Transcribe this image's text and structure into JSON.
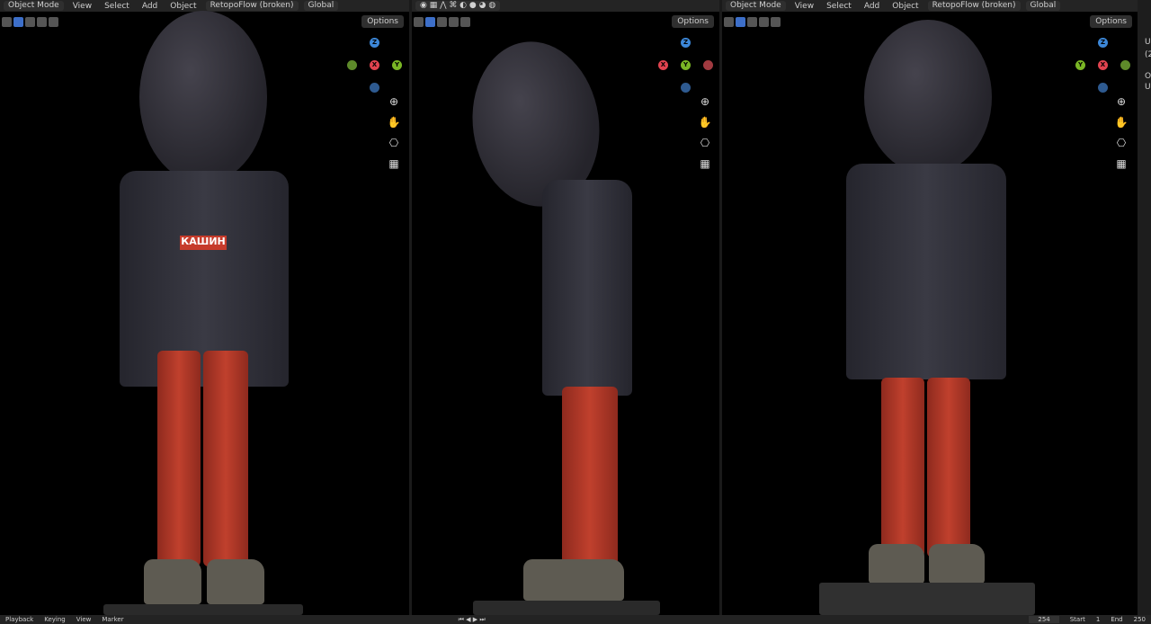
{
  "header": {
    "mode": "Object Mode",
    "menus": [
      "View",
      "Select",
      "Add",
      "Object"
    ],
    "addon": "RetopoFlow (broken)",
    "transform": "Global",
    "options": "Options"
  },
  "viewports": [
    {
      "name": "front",
      "gizmo": [
        "Z",
        "X",
        "Y"
      ],
      "shirt_text": "КАШИН"
    },
    {
      "name": "side",
      "gizmo": [
        "Z",
        "X",
        "Y"
      ]
    },
    {
      "name": "back",
      "gizmo": [
        "Z",
        "X",
        "Y"
      ]
    }
  ],
  "icons": {
    "zoom": "magnifier-plus-icon",
    "pan": "hand-icon",
    "camera": "camera-icon",
    "grid": "grid-icon"
  },
  "timeline": {
    "menus": [
      "Playback",
      "Keying",
      "View",
      "Marker"
    ],
    "current_frame": "254",
    "start_label": "Start",
    "start": "1",
    "end_label": "End",
    "end": "250"
  },
  "side_panel": [
    "U",
    "(2",
    "O",
    "U"
  ],
  "colors": {
    "x_axis": "#e0434f",
    "y_axis": "#7ab625",
    "z_axis": "#3c87d8",
    "active_tool": "#3d6fc9"
  }
}
